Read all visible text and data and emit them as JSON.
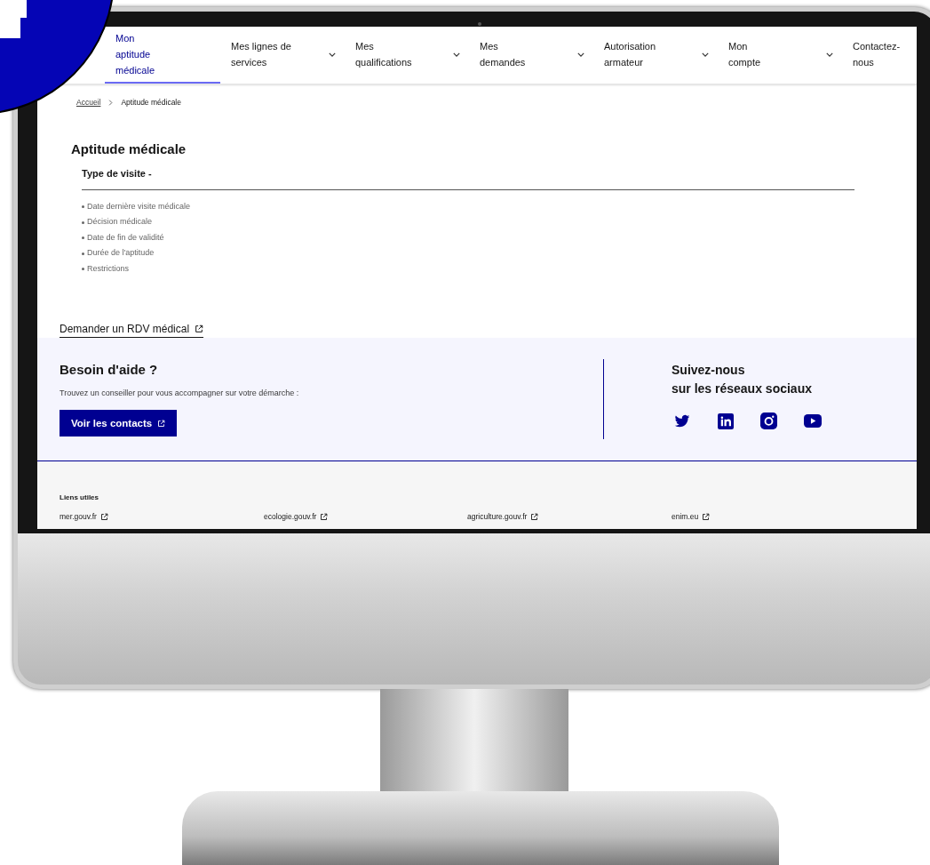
{
  "nav": {
    "items": [
      {
        "label": "Mon aptitude médicale",
        "selected": true,
        "dropdown": false
      },
      {
        "label": "Mes lignes de services",
        "selected": false,
        "dropdown": true
      },
      {
        "label": "Mes qualifications",
        "selected": false,
        "dropdown": true
      },
      {
        "label": "Mes demandes",
        "selected": false,
        "dropdown": true
      },
      {
        "label": "Autorisation armateur",
        "selected": false,
        "dropdown": true
      },
      {
        "label": "Mon compte",
        "selected": false,
        "dropdown": true
      },
      {
        "label": "Contactez-nous",
        "selected": false,
        "dropdown": false
      }
    ]
  },
  "breadcrumb": [
    {
      "label": "Accueil",
      "current": false
    },
    {
      "label": "Aptitude médicale",
      "current": true
    }
  ],
  "main": {
    "title": "Aptitude médicale",
    "subtitle": "Type de visite -",
    "fields": [
      "Date dernière visite médicale",
      "Décision médicale",
      "Date de fin de validité",
      "Durée de l'aptitude",
      "Restrictions"
    ],
    "rdv_link": "Demander un RDV médical"
  },
  "help": {
    "title": "Besoin d'aide ?",
    "text": "Trouvez un conseiller pour vous accompagner sur votre démarche :",
    "button": "Voir les contacts"
  },
  "social": {
    "title_lines": [
      "Suivez-nous",
      "sur les réseaux sociaux"
    ],
    "networks": [
      {
        "kind": "twitter"
      },
      {
        "kind": "linkedin"
      },
      {
        "kind": "instagram"
      },
      {
        "kind": "youtube"
      }
    ]
  },
  "footer": {
    "title": "Liens utiles",
    "links": [
      "mer.gouv.fr",
      "ecologie.gouv.fr",
      "agriculture.gouv.fr",
      "enim.eu"
    ]
  }
}
